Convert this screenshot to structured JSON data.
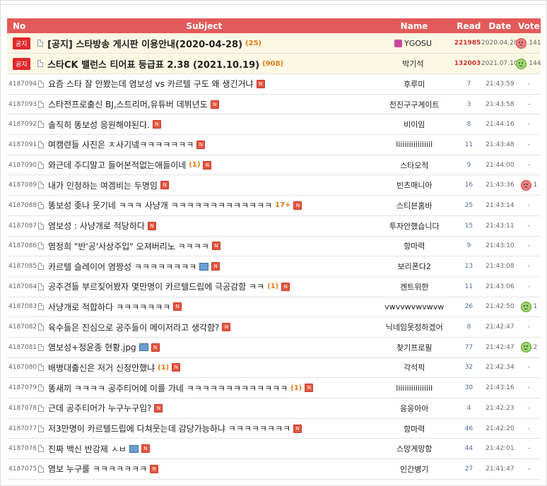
{
  "header": {
    "no": "No",
    "subject": "Subject",
    "name": "Name",
    "read": "Read",
    "date": "Date",
    "vote": "Vote"
  },
  "notices": [
    {
      "badge": "공지",
      "title": "[공지] 스타방송 게시판 이용안내(2020-04-28)",
      "comments": "(25)",
      "name": "YGOSU",
      "read": "221985",
      "date": "2020.04.28",
      "vote_icon": "sad",
      "vote": "141"
    },
    {
      "badge": "공지",
      "title": "스타CK 밸런스 티어표 등급표 2.38 (2021.10.19)",
      "comments": "(908)",
      "name": "박기석",
      "read": "132003",
      "date": "2021.07.10",
      "vote_icon": "happy",
      "vote": "144"
    }
  ],
  "posts": [
    {
      "no": "4187094",
      "title": "요즘 스타 잘 안봤는데 염보성 vs 카르텔 구도 왜 생긴거냐",
      "comments": "",
      "name": "후루미",
      "read": "7",
      "date": "21:43:59",
      "vote": "-"
    },
    {
      "no": "4187093",
      "title": "스타전프로출신 BJ,스트리머,유튜버 데뷔년도",
      "comments": "",
      "name": "전진구구게이트",
      "read": "3",
      "date": "21:43:58",
      "vote": "-"
    },
    {
      "no": "4187092",
      "title": "솔직히 똥보성 응원해야된다.",
      "comments": "",
      "name": "비이임",
      "read": "8",
      "date": "21:44:16",
      "vote": "-"
    },
    {
      "no": "4187091",
      "title": "여캠련들 사진은 ㅈ사기넼ㅋㅋㅋㅋㅋㅋㅋ",
      "comments": "",
      "name": "liiiiiiiiiiiiiiil",
      "read": "11",
      "date": "21:43:48",
      "vote": "-"
    },
    {
      "no": "4187090",
      "title": "와근데 주디말고 들어본적없는애들이네",
      "comments": "(1)",
      "name": "스타오적",
      "read": "9",
      "date": "21:44:00",
      "vote": "-"
    },
    {
      "no": "4187089",
      "title": "내가 인정하는 여겜비는 두명임",
      "comments": "",
      "name": "빈츠매니아",
      "read": "16",
      "date": "21:43:36",
      "vote_icon": "sad",
      "vote": "1"
    },
    {
      "no": "4187088",
      "title": "똥보성 좆나 웃기네 ㅋㅋㅋ 사냥개 ㅋㅋㅋㅋㅋㅋㅋㅋㅋㅋㅋㅋㅋ",
      "comments": "17+",
      "name": "스티븐홈바",
      "read": "25",
      "date": "21:43:14",
      "vote": "-"
    },
    {
      "no": "4187087",
      "title": "염보성 : 사냥개로 적당하다",
      "comments": "",
      "name": "투자안했습니다",
      "read": "15",
      "date": "21:43:11",
      "vote": "-"
    },
    {
      "no": "4187086",
      "title": "염정희 \"반'공'사상주입\" 오져버리노 ㅋㅋㅋㅋ",
      "comments": "",
      "name": "항마력",
      "read": "9",
      "date": "21:43:10",
      "vote": "-"
    },
    {
      "no": "4187085",
      "title": "카르텔 슬레이어 염짱성 ㅋㅋㅋㅋㅋㅋㅋㅋ",
      "comments": "",
      "img": true,
      "name": "보리폰다2",
      "read": "13",
      "date": "21:43:08",
      "vote": "-"
    },
    {
      "no": "4187084",
      "title": "공주견들 부르짖어봤자 몇만명이 카르텔드립에 극공감함 ㅋㅋ",
      "comments": "(1)",
      "name": "겐트위한",
      "read": "11",
      "date": "21:43:06",
      "vote": "-"
    },
    {
      "no": "4187083",
      "title": "사냥개로 적합하다 ㅋㅋㅋㅋㅋㅋㅋ",
      "comments": "",
      "name": "vwvvwvwvwvw",
      "read": "26",
      "date": "21:42:50",
      "vote_icon": "happy",
      "vote": "1"
    },
    {
      "no": "4187082",
      "title": "육수들은 진심으로 공주들이 메이저라고 생각함?",
      "comments": "",
      "name": "닉네임못정하겠어",
      "read": "8",
      "date": "21:42:47",
      "vote": "-"
    },
    {
      "no": "4187081",
      "title": "염보성+정윤종 현황.jpg",
      "comments": "",
      "img": true,
      "name": "찾기프로필",
      "read": "77",
      "date": "21:42:47",
      "vote_icon": "happy",
      "vote": "2"
    },
    {
      "no": "4187080",
      "title": "배병대출신은 저거 신청안했냐",
      "comments": "(1)",
      "name": "각석픽",
      "read": "32",
      "date": "21:42:34",
      "vote": "-"
    },
    {
      "no": "4187079",
      "title": "똥새끼 ㅋㅋㅋㅋ 공주티어에 이를 가네 ㅋㅋㅋㅋㅋㅋㅋㅋㅋㅋㅋㅋㅋ",
      "comments": "(1)",
      "name": "liiiiiiiiiiiiiiil",
      "read": "30",
      "date": "21:43:16",
      "vote": "-"
    },
    {
      "no": "4187078",
      "title": "근데 공주티어가 누구누구임?",
      "comments": "",
      "name": "응응아아",
      "read": "4",
      "date": "21:42:23",
      "vote": "-"
    },
    {
      "no": "4187077",
      "title": "저3만명이 카르텔드립에 다쳐웃는데 감당가능하냐 ㅋㅋㅋㅋㅋㅋㅋㅋ",
      "comments": "",
      "name": "항마력",
      "read": "46",
      "date": "21:42:20",
      "vote": "-"
    },
    {
      "no": "4187076",
      "title": "진짜 백신 반강제 ㅅㅂ",
      "comments": "",
      "img": true,
      "name": "스망게망함",
      "read": "44",
      "date": "21:42:01",
      "vote": "-"
    },
    {
      "no": "4187075",
      "title": "염보 누구를 ㅋㅋㅋㅋㅋㅋㅋ",
      "comments": "",
      "name": "인간병기",
      "read": "27",
      "date": "21:41:47",
      "vote": "-"
    }
  ]
}
